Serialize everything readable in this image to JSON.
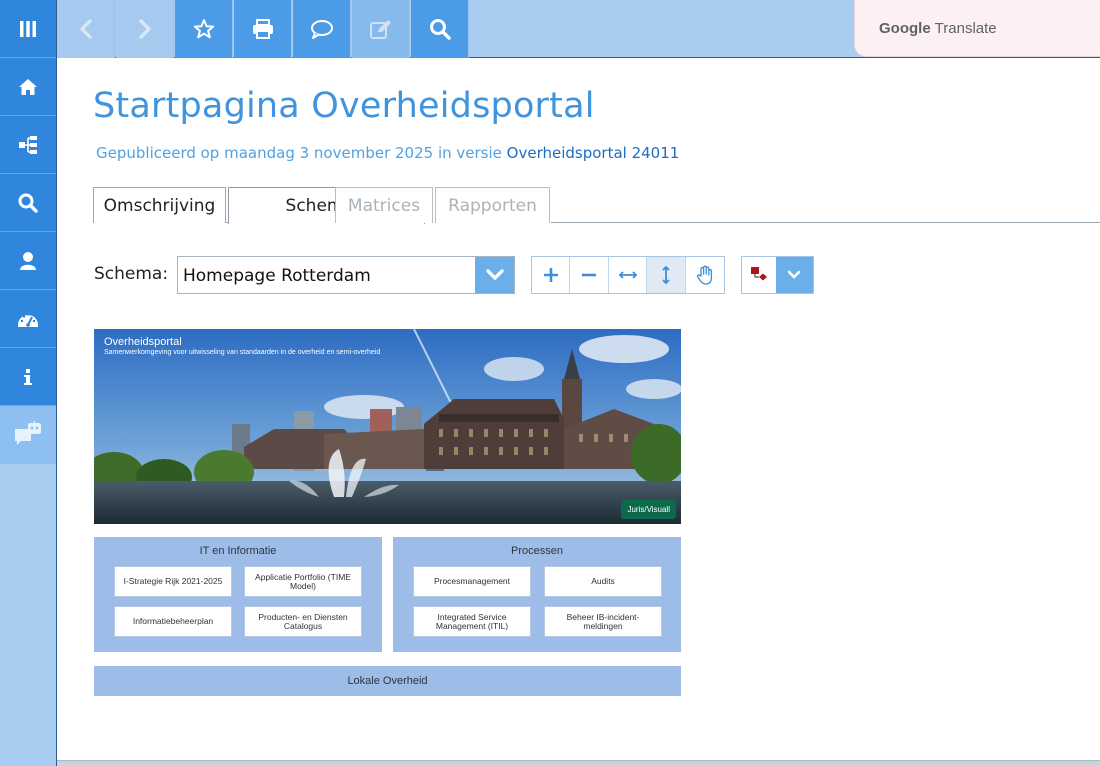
{
  "sidebar": {
    "items": [
      {
        "name": "menu",
        "icon": "bars-icon"
      },
      {
        "name": "home",
        "icon": "home-icon"
      },
      {
        "name": "tree",
        "icon": "sitemap-icon"
      },
      {
        "name": "search",
        "icon": "search-icon"
      },
      {
        "name": "user",
        "icon": "user-icon"
      },
      {
        "name": "dashboard",
        "icon": "dashboard-icon"
      },
      {
        "name": "info",
        "icon": "info-icon"
      },
      {
        "name": "chatbot",
        "icon": "chatbot-icon"
      }
    ]
  },
  "toolbar": {
    "buttons": [
      "back-icon",
      "forward-icon",
      "star-icon",
      "print-icon",
      "comment-icon",
      "edit-icon",
      "search-icon"
    ]
  },
  "google_translate": {
    "brand": "Google",
    "label": "Translate"
  },
  "page": {
    "title": "Startpagina Overheidsportal",
    "published_prefix": "Gepubliceerd op maandag 3 november 2025 in versie",
    "version_link": "Overheidsportal 24011"
  },
  "tabs": [
    {
      "label": "Omschrijving",
      "state": "normal"
    },
    {
      "label": "Schema's",
      "state": "active"
    },
    {
      "label": "Matrices",
      "state": "disabled"
    },
    {
      "label": "Rapporten",
      "state": "disabled"
    }
  ],
  "schema": {
    "label": "Schema:",
    "selected": "Homepage Rotterdam"
  },
  "diagram": {
    "banner_title": "Overheidsportal",
    "banner_subtitle": "Samenwerkomgeving voor uitwisseling van standaarden in de overheid en semi-overheid",
    "badge": "Juris/Visuall",
    "panel_it": {
      "title": "IT en Informatie",
      "cards": [
        "I-Strategie Rijk 2021-2025",
        "Applicatie Portfolio (TIME Model)",
        "Informatiebeheerplan",
        "Producten- en Diensten Catalogus"
      ]
    },
    "panel_processen": {
      "title": "Processen",
      "cards": [
        "Procesmanagement",
        "Audits",
        "Integrated Service Management (ITIL)",
        "Beheer IB-incident-meldingen"
      ]
    },
    "lokaal": "Lokale Overheid"
  },
  "colors": {
    "accent": "#3f94dd",
    "sidebar_active": "#2f86dc",
    "panel": "#9dbde8"
  }
}
